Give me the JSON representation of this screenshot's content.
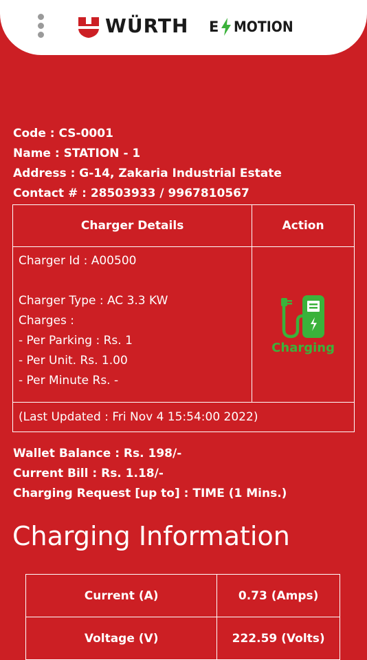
{
  "header": {
    "brand_name": "WÜRTH",
    "sub_brand_prefix": "E",
    "sub_brand_suffix": "MOTION",
    "icons": [
      "menu-dots-icon",
      "wurth-logo-icon",
      "lightning-bolt-icon"
    ]
  },
  "station": {
    "code_line": "Code : CS-0001",
    "name_line": "Name : STATION - 1",
    "address_line": "Address : G-14, Zakaria Industrial Estate",
    "contact_line": "Contact # : 28503933 / 9967810567"
  },
  "charger_table": {
    "headers": [
      "Charger Details",
      "Action"
    ],
    "charger_id": "Charger Id : A00500",
    "charger_type": "Charger Type : AC 3.3 KW",
    "charges_label": "Charges :",
    "per_parking": "- Per Parking : Rs. 1",
    "per_unit": "- Per Unit. Rs. 1.00",
    "per_minute": "- Per Minute Rs. -",
    "action_status": "Charging",
    "last_updated": "(Last Updated : Fri Nov 4 15:54:00 2022)"
  },
  "wallet": {
    "balance_line": "Wallet Balance : Rs. 198/-",
    "bill_line": "Current Bill : Rs. 1.18/-",
    "request_line": "Charging Request [up to] : TIME (1 Mins.)"
  },
  "charging_info": {
    "title": "Charging Information",
    "rows": [
      {
        "label": "Current (A)",
        "value": "0.73 (Amps)"
      },
      {
        "label": "Voltage (V)",
        "value": "222.59 (Volts)"
      }
    ]
  },
  "colors": {
    "background": "#cc1f24",
    "header_bg": "#ffffff",
    "charging_green": "#3bb23b",
    "text": "#ffffff"
  }
}
